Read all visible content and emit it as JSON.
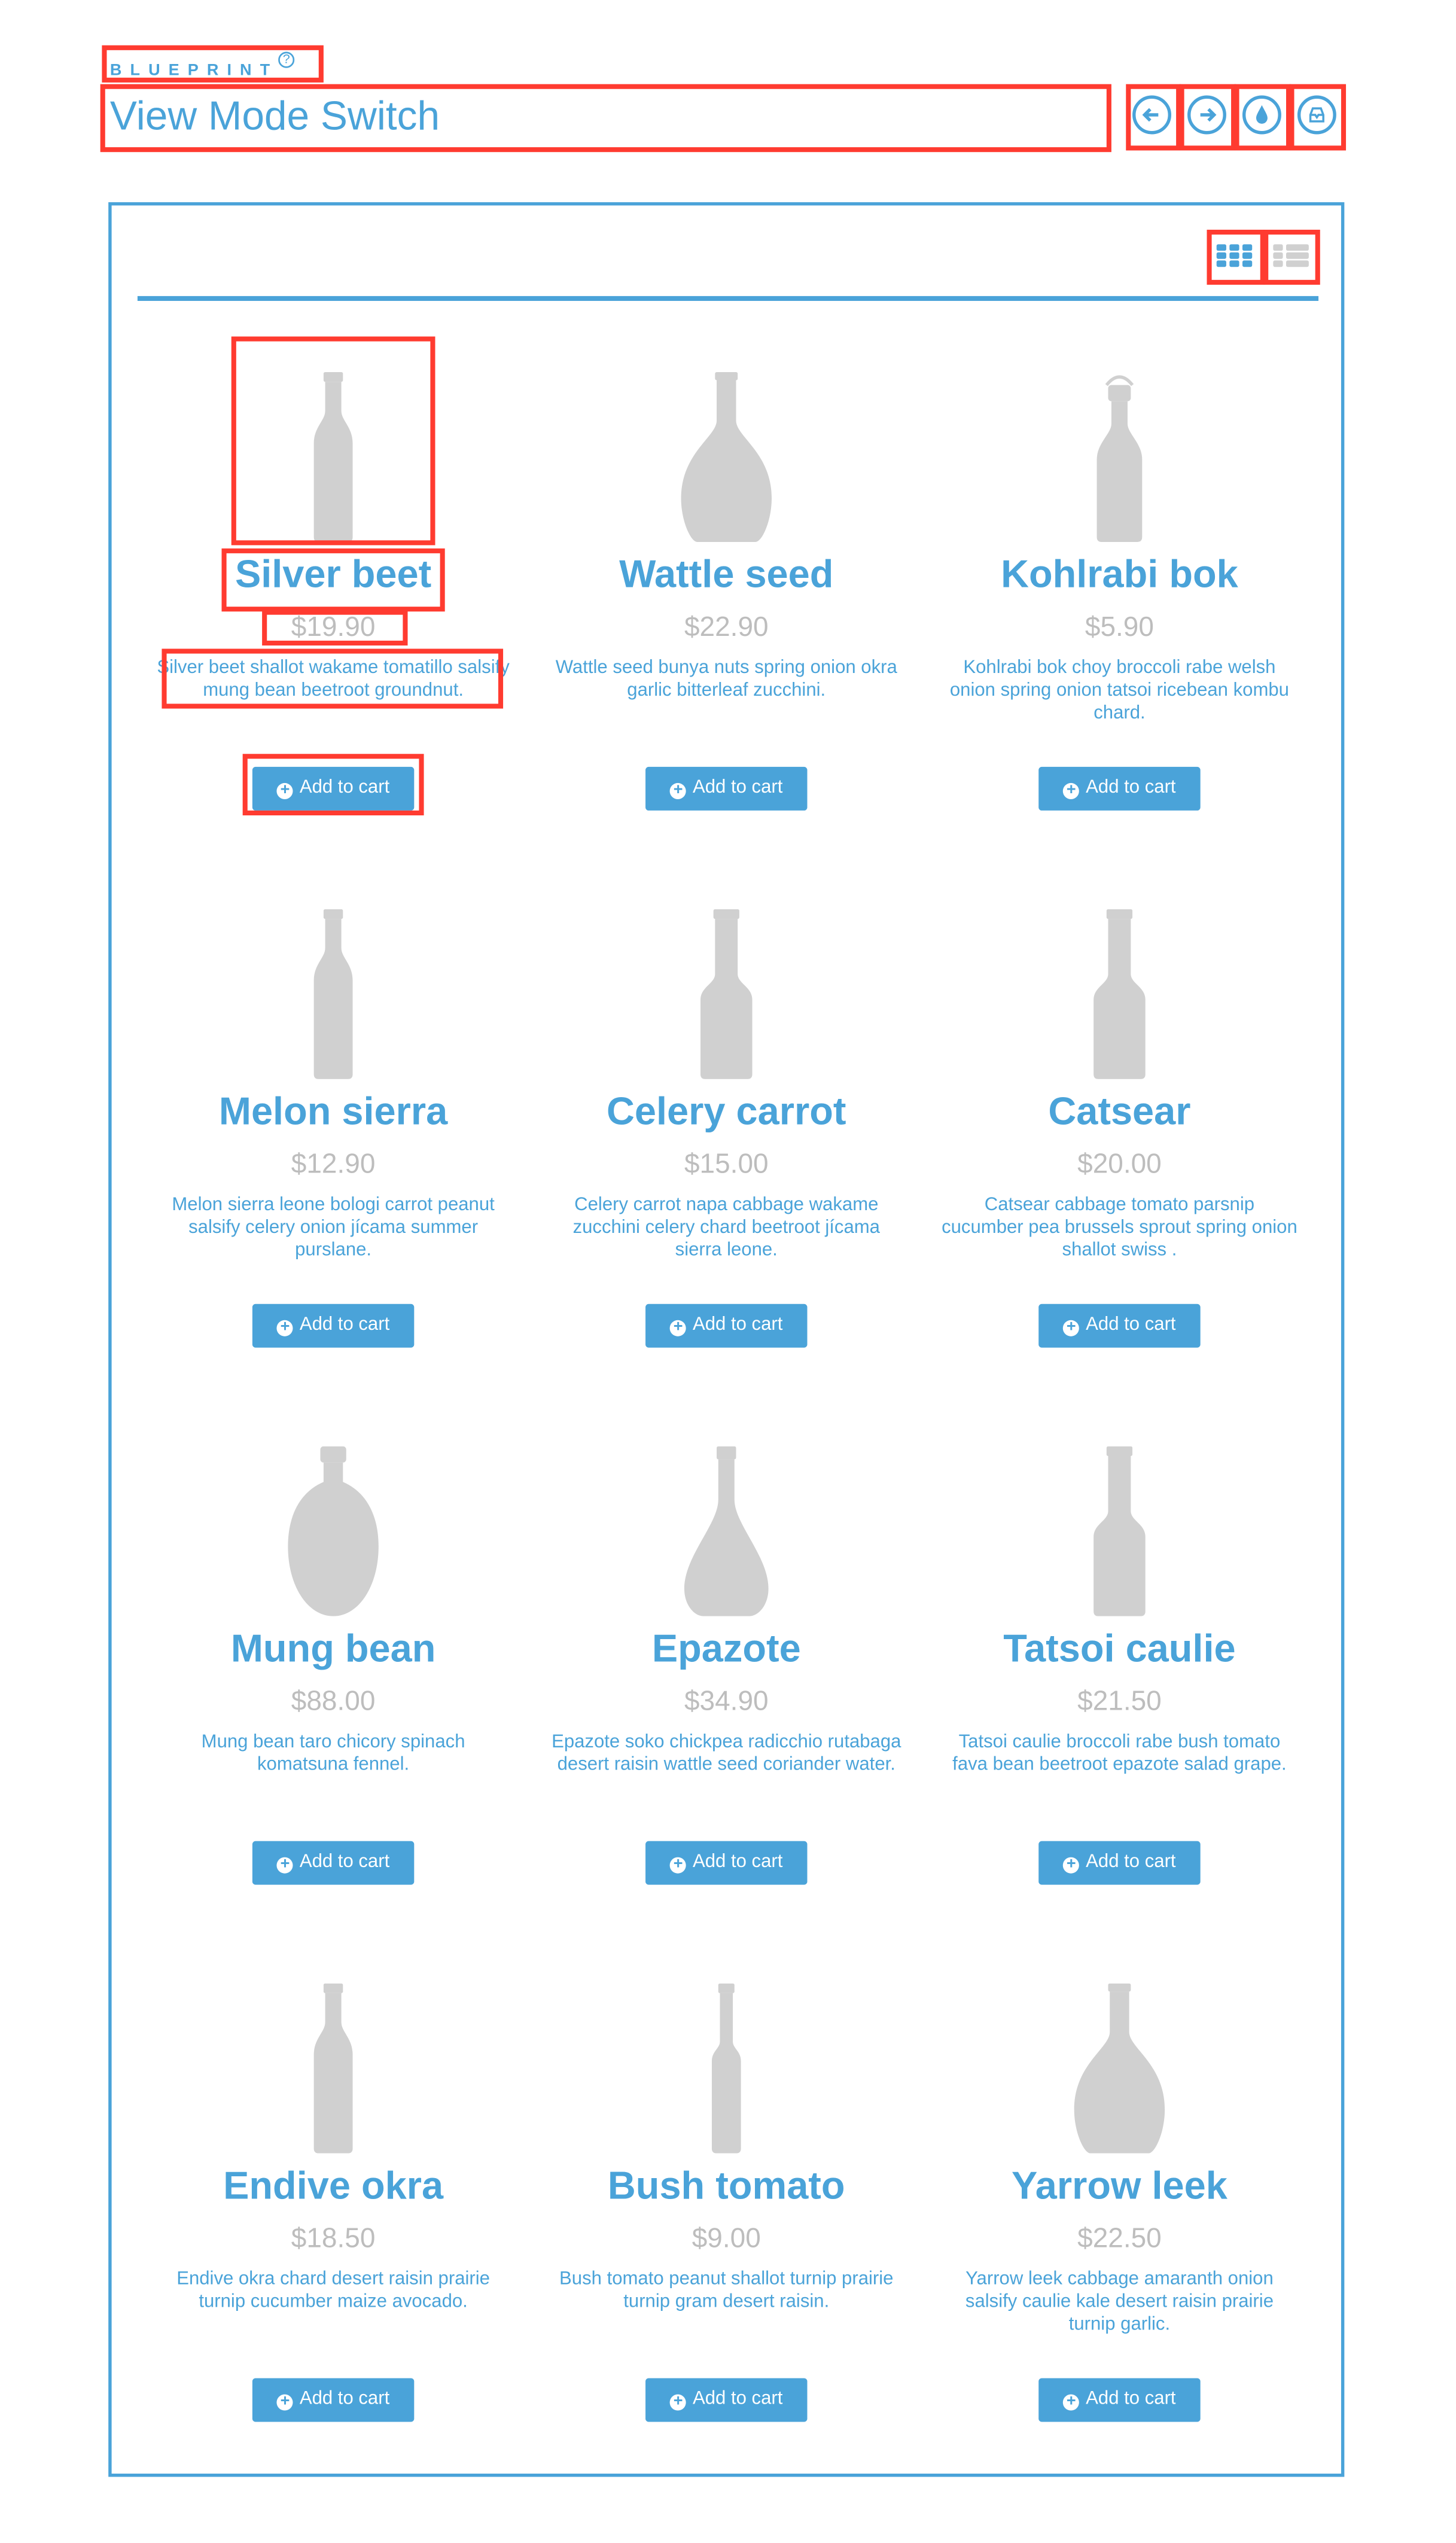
{
  "header": {
    "brand": "BLUEPRINT",
    "brand_badge": "?",
    "title": "View Mode Switch",
    "actions": [
      {
        "icon": "arrow-left-icon"
      },
      {
        "icon": "arrow-right-icon"
      },
      {
        "icon": "drop-icon"
      },
      {
        "icon": "inbox-icon"
      }
    ]
  },
  "view_toggle": {
    "active": "grid",
    "options": [
      {
        "icon": "grid-view-icon"
      },
      {
        "icon": "list-view-icon"
      }
    ]
  },
  "colors": {
    "accent": "#4aa3d9",
    "price": "#bdbdbd",
    "bottle": "#d0d0d0",
    "annotation": "#ff3b30"
  },
  "add_to_cart_label": "Add to cart",
  "products": [
    {
      "name": "Silver beet",
      "price": "$19.90",
      "description": "Silver beet shallot wakame tomatillo salsify mung bean beetroot groundnut.",
      "bottle": "slim"
    },
    {
      "name": "Wattle seed",
      "price": "$22.90",
      "description": "Wattle seed bunya nuts spring onion okra garlic bitterleaf zucchini.",
      "bottle": "wide"
    },
    {
      "name": "Kohlrabi bok",
      "price": "$5.90",
      "description": "Kohlrabi bok choy broccoli rabe welsh onion spring onion tatsoi ricebean kombu chard.",
      "bottle": "swing"
    },
    {
      "name": "Melon sierra",
      "price": "$12.90",
      "description": "Melon sierra leone bologi carrot peanut salsify celery onion jícama summer purslane.",
      "bottle": "slim"
    },
    {
      "name": "Celery carrot",
      "price": "$15.00",
      "description": "Celery carrot napa cabbage wakame zucchini celery chard beetroot jícama sierra leone.",
      "bottle": "square"
    },
    {
      "name": "Catsear",
      "price": "$20.00",
      "description": "Catsear cabbage tomato parsnip cucumber pea brussels sprout spring onion shallot swiss .",
      "bottle": "square"
    },
    {
      "name": "Mung bean",
      "price": "$88.00",
      "description": "Mung bean taro chicory spinach komatsuna fennel.",
      "bottle": "round"
    },
    {
      "name": "Epazote",
      "price": "$34.90",
      "description": "Epazote soko chickpea radicchio rutabaga desert raisin wattle seed coriander water.",
      "bottle": "flask"
    },
    {
      "name": "Tatsoi caulie",
      "price": "$21.50",
      "description": "Tatsoi caulie broccoli rabe bush tomato fava bean beetroot epazote salad grape.",
      "bottle": "square"
    },
    {
      "name": "Endive okra",
      "price": "$18.50",
      "description": "Endive okra chard desert raisin prairie turnip cucumber maize avocado.",
      "bottle": "slim"
    },
    {
      "name": "Bush tomato",
      "price": "$9.00",
      "description": "Bush tomato peanut shallot turnip prairie turnip gram desert raisin.",
      "bottle": "thin"
    },
    {
      "name": "Yarrow leek",
      "price": "$22.50",
      "description": "Yarrow leek cabbage amaranth onion salsify caulie kale desert raisin prairie turnip garlic.",
      "bottle": "wide"
    }
  ]
}
